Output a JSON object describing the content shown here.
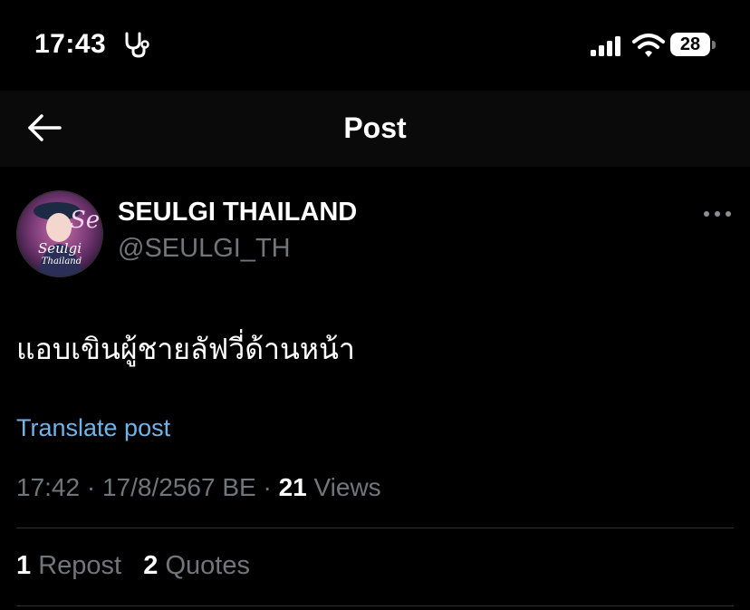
{
  "status_bar": {
    "time": "17:43",
    "battery_level": "28",
    "icons": [
      "stethoscope-icon",
      "cellular-signal-icon",
      "wifi-icon",
      "battery-icon"
    ]
  },
  "header": {
    "title": "Post",
    "back_icon": "arrow-left-icon"
  },
  "post": {
    "author": {
      "display_name": "SEULGI THAILAND",
      "handle": "@SEULGI_TH",
      "avatar_text": {
        "script": "Seul",
        "line1": "Seulgi",
        "line2": "Thailand"
      }
    },
    "more_icon": "more-horizontal-icon",
    "text": "แอบเขินผู้ชายลัฟวี่ด้านหน้า",
    "translate_label": "Translate post",
    "time": "17:42",
    "date": "17/8/2567 BE",
    "separator": "·",
    "views_count": "21",
    "views_label": "Views",
    "reposts_count": "1",
    "reposts_label": "Repost",
    "quotes_count": "2",
    "quotes_label": "Quotes"
  },
  "colors": {
    "background": "#000000",
    "header_background": "#0a0a0a",
    "secondary_text": "#71767b",
    "link": "#6fb4eb",
    "divider": "#2f3336"
  }
}
